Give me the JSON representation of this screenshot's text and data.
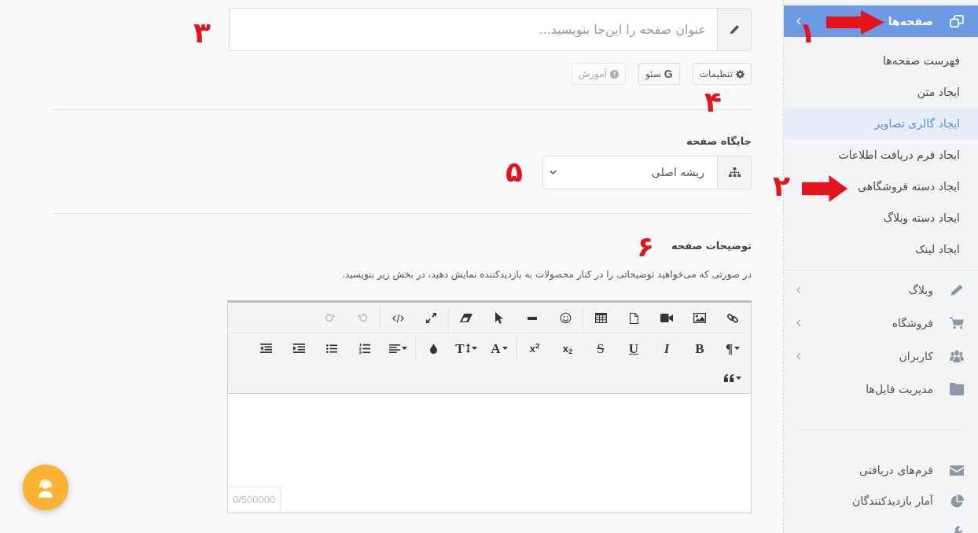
{
  "sidebar": {
    "menu": [
      {
        "label": "صفحه‌ها",
        "selected": true,
        "has_submenu": true,
        "children": [
          {
            "label": "فهرست صفحه‌ها",
            "selected": false
          },
          {
            "label": "ایجاد متن",
            "selected": false
          },
          {
            "label": "ایجاد گالری تصاویر",
            "selected": true
          },
          {
            "label": "ایجاد فرم دریافت اطلاعات",
            "selected": false
          },
          {
            "label": "ایجاد دسته فروشگاهی",
            "selected": false
          },
          {
            "label": "ایجاد دسته وبلاگ",
            "selected": false
          },
          {
            "label": "ایجاد لینک",
            "selected": false
          }
        ]
      },
      {
        "label": "وبلاگ",
        "selected": false,
        "has_submenu": true
      },
      {
        "label": "فروشگاه",
        "selected": false,
        "has_submenu": true
      },
      {
        "label": "کاربران",
        "selected": false,
        "has_submenu": true
      },
      {
        "label": "مدیریت فایل‌ها",
        "selected": false,
        "has_submenu": false
      }
    ],
    "secondary_menu": [
      {
        "label": "فرم‌های دریافتی",
        "selected": false
      },
      {
        "label": "آمار بازدیدکنندگان",
        "selected": false
      }
    ]
  },
  "title_field": {
    "placeholder": "عنوان صفحه را این‌جا بنویسید..."
  },
  "action_buttons": [
    {
      "label": "تنظیمات",
      "disabled": false
    },
    {
      "icon_text": "G",
      "label": "سئو",
      "disabled": false
    },
    {
      "label": "آموزش",
      "disabled": true
    }
  ],
  "page_location": {
    "label": "جایگاه صفحه",
    "value": "ریشه اصلی"
  },
  "description": {
    "label": "توضیحات صفحه",
    "help": "در صورتی که می‌خواهید توضیحاتی را در کنار محصولات به بازدیدکننده نمایش دهید، در بخش زیر بنویسید.",
    "editor": {
      "toolbar_labels": [
        {
          "text": "¶",
          "kind": "serif"
        },
        {
          "text": "B",
          "kind": "bold"
        },
        {
          "text": "I",
          "kind": "italic"
        },
        {
          "text": "U",
          "kind": "underline"
        },
        {
          "text": "S",
          "kind": "strike"
        },
        {
          "text": "x$_{2}$",
          "kind": "plain"
        },
        {
          "text": "x$^{2}$",
          "kind": "plain"
        },
        {
          "text": "A",
          "kind": "serif"
        },
        {
          "text": "T",
          "kind": "serif"
        }
      ],
      "undo": {
        "disabled": true
      },
      "redo": {
        "disabled": true
      },
      "counter": "0/500000"
    }
  },
  "annotations": [
    "۱",
    "۲",
    "۳",
    "۴",
    "۵",
    "۶"
  ]
}
